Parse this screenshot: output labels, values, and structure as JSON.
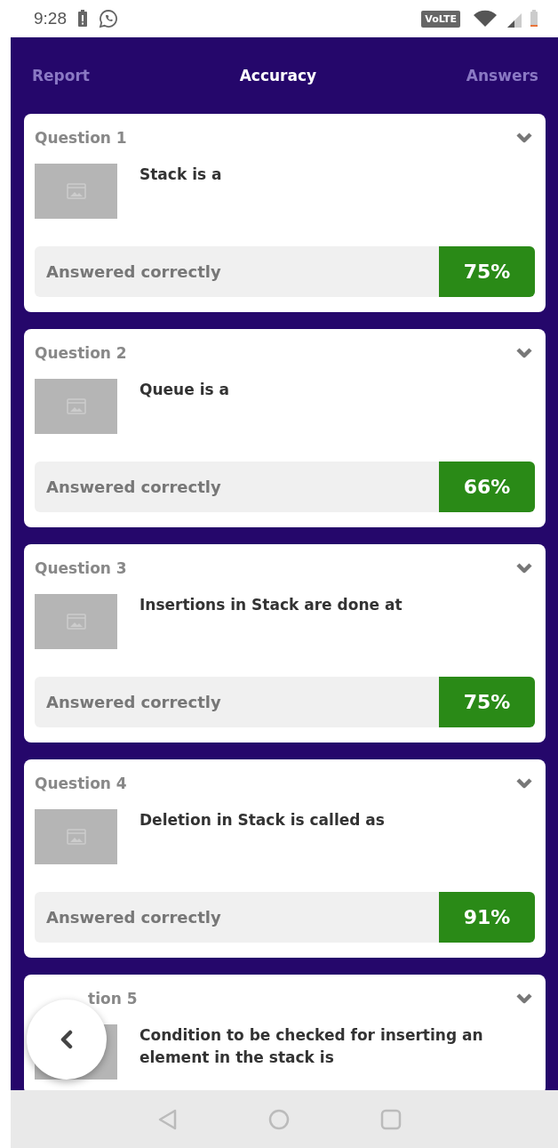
{
  "status_bar": {
    "time": "9:28",
    "network_label": "VoLTE"
  },
  "tabs": [
    {
      "label": "Report",
      "selected": false
    },
    {
      "label": "Accuracy",
      "selected": true
    },
    {
      "label": "Answers",
      "selected": false
    }
  ],
  "questions": [
    {
      "title": "Question 1",
      "text": "Stack is a",
      "result_label": "Answered correctly",
      "percent": "75%",
      "covered": false
    },
    {
      "title": "Question 2",
      "text": "Queue is a",
      "result_label": "Answered correctly",
      "percent": "66%",
      "covered": false
    },
    {
      "title": "Question 3",
      "text": "Insertions in Stack are done at",
      "result_label": "Answered correctly",
      "percent": "75%",
      "covered": false
    },
    {
      "title": "Question 4",
      "text": "Deletion in Stack is called as",
      "result_label": "Answered correctly",
      "percent": "91%",
      "covered": false
    },
    {
      "title": "tion 5",
      "text": "Condition to be checked for inserting an element in the stack is",
      "covered": true
    }
  ]
}
